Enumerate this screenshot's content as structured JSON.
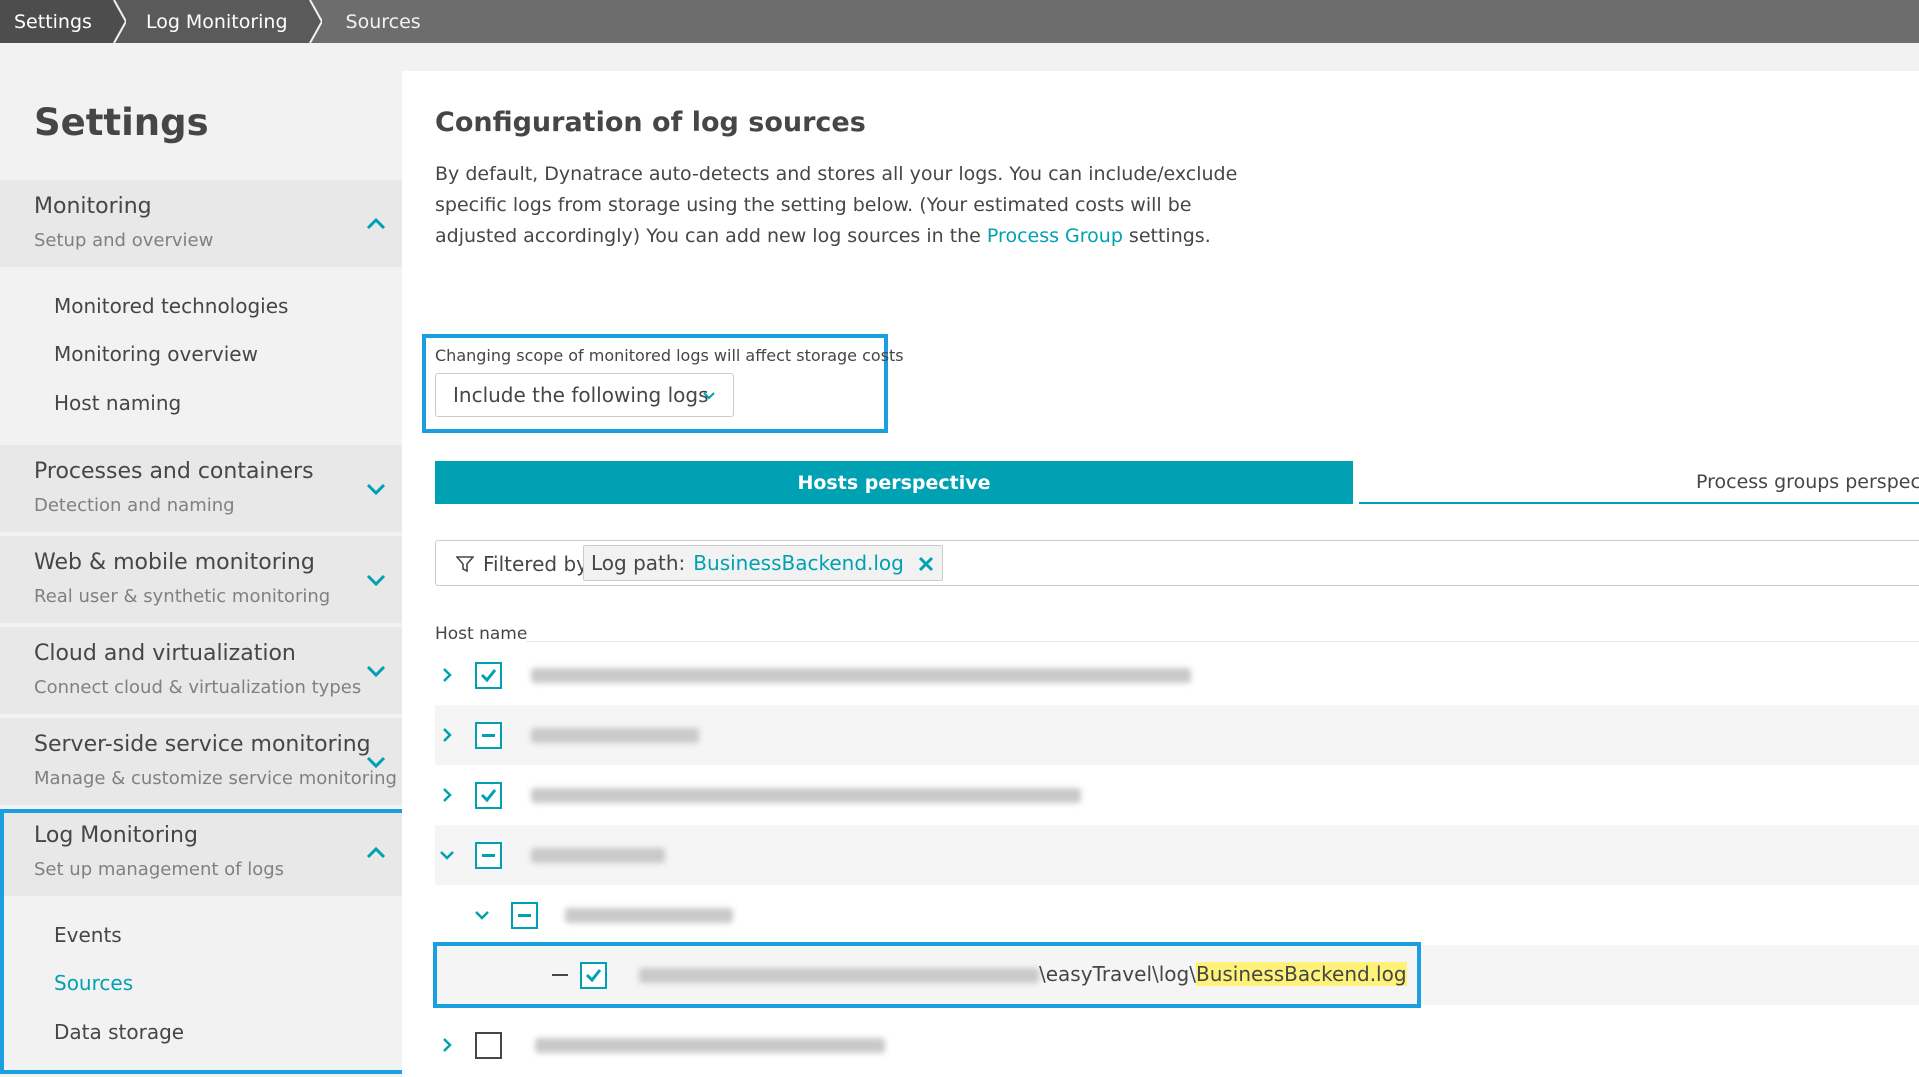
{
  "breadcrumb": [
    "Settings",
    "Log Monitoring",
    "Sources"
  ],
  "sidebar": {
    "title": "Settings",
    "sections": [
      {
        "title": "Monitoring",
        "subtitle": "Setup and overview",
        "expanded": true,
        "items": [
          "Monitored technologies",
          "Monitoring overview",
          "Host naming"
        ]
      },
      {
        "title": "Processes and containers",
        "subtitle": "Detection and naming",
        "expanded": false
      },
      {
        "title": "Web & mobile monitoring",
        "subtitle": "Real user & synthetic monitoring",
        "expanded": false
      },
      {
        "title": "Cloud and virtualization",
        "subtitle": "Connect cloud & virtualization types",
        "expanded": false
      },
      {
        "title": "Server-side service monitoring",
        "subtitle": "Manage & customize service monitoring",
        "expanded": false
      },
      {
        "title": "Log Monitoring",
        "subtitle": "Set up management of logs",
        "expanded": true,
        "items": [
          "Events",
          "Sources",
          "Data storage"
        ],
        "active_item": "Sources"
      }
    ]
  },
  "main": {
    "title": "Configuration of log sources",
    "desc_1": "By default, Dynatrace auto-detects and stores all your logs. You can include/exclude specific logs from storage using the setting below. (Your estimated costs will be adjusted accordingly) You can add new log sources in the ",
    "desc_link": "Process Group",
    "desc_2": " settings.",
    "scope_label": "Changing scope of monitored logs will affect storage costs",
    "scope_value": "Include the following logs",
    "tabs": {
      "active": "Hosts perspective",
      "inactive": "Process groups perspective"
    },
    "filter": {
      "label": "Filtered by",
      "chip_key": "Log path:",
      "chip_value": "BusinessBackend.log"
    },
    "column_header": "Host name",
    "path_visible": "\\easyTravel\\log\\",
    "path_highlight": "BusinessBackend.log"
  },
  "colors": {
    "accent": "#00a1b2",
    "highlight_box": "#1a9fe0",
    "path_highlight": "#fff27a"
  }
}
